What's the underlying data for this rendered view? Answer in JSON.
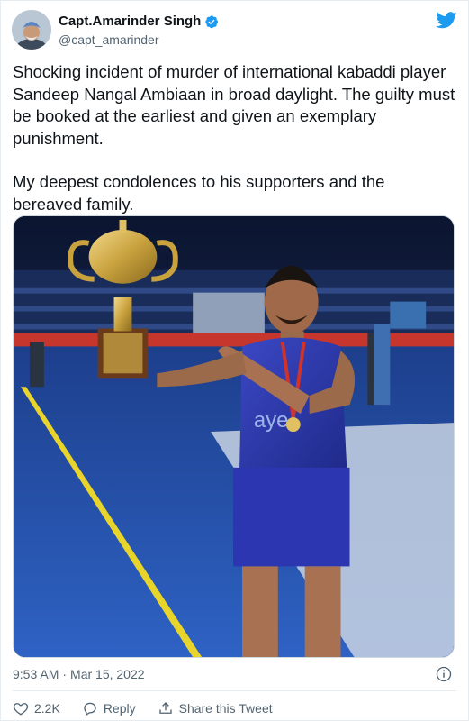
{
  "author": {
    "display_name": "Capt.Amarinder Singh",
    "handle": "@capt_amarinder"
  },
  "tweet": {
    "paragraphs": [
      "Shocking incident of murder of international kabaddi player Sandeep Nangal Ambiaan in broad daylight. The guilty must be booked at the earliest and given an exemplary punishment.",
      "My deepest condolences to his supporters and the bereaved family."
    ]
  },
  "meta": {
    "time": "9:53 AM",
    "separator": "·",
    "date": "Mar 15, 2022"
  },
  "actions": {
    "like_count": "2.2K",
    "reply_label": "Reply",
    "share_label": "Share this Tweet"
  },
  "colors": {
    "brand_blue": "#1d9bf0",
    "text_secondary": "#536471"
  },
  "icons": {
    "verified": "verified-badge-icon",
    "brand": "twitter-bird-icon",
    "info": "info-icon",
    "like": "heart-icon",
    "reply": "reply-icon",
    "share": "share-icon"
  }
}
